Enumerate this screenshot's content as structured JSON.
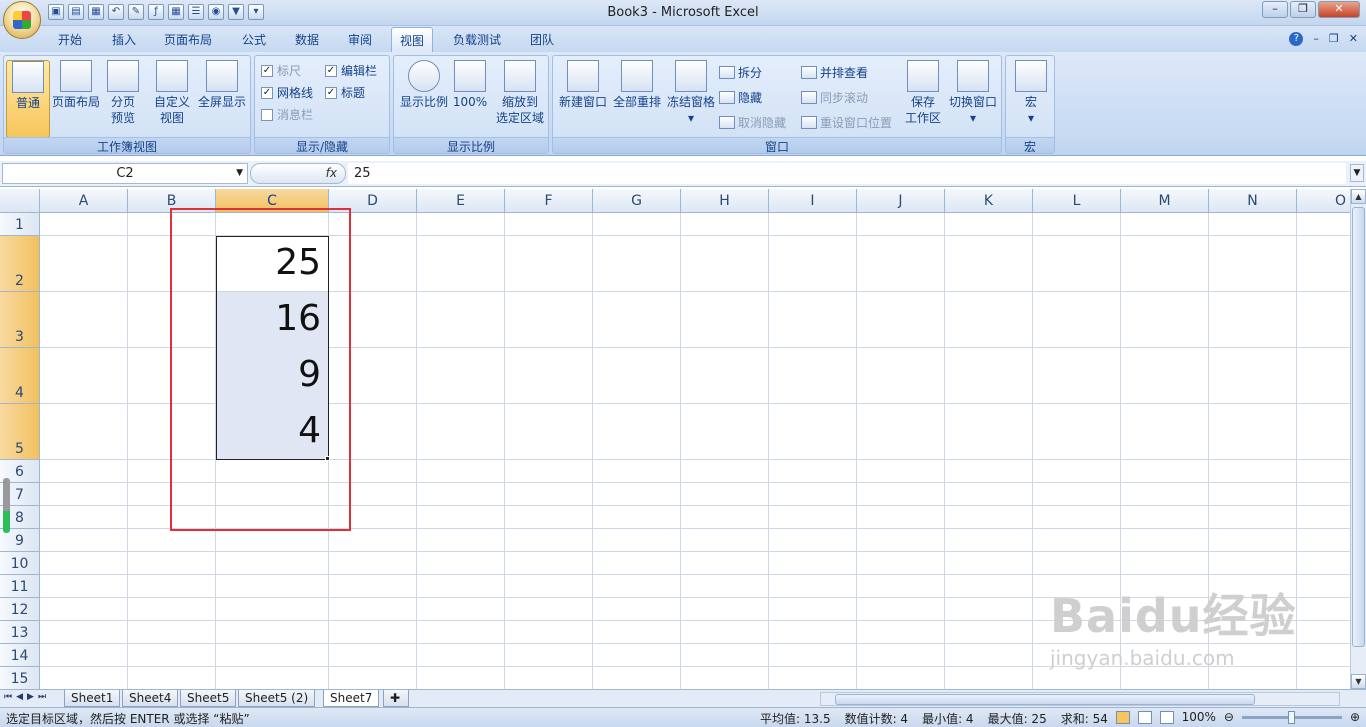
{
  "window": {
    "title": "Book3 - Microsoft Excel"
  },
  "tabs": [
    "开始",
    "插入",
    "页面布局",
    "公式",
    "数据",
    "审阅",
    "视图",
    "负载测试",
    "团队"
  ],
  "active_tab": "视图",
  "ribbon": {
    "workbook_views": {
      "label": "工作簿视图",
      "normal": "普通",
      "page_layout": "页面布局",
      "page_break_1": "分页",
      "page_break_2": "预览",
      "custom_1": "自定义",
      "custom_2": "视图",
      "fullscreen": "全屏显示"
    },
    "show_hide": {
      "label": "显示/隐藏",
      "ruler": "标尺",
      "gridlines": "网格线",
      "message_bar": "消息栏",
      "formula_bar": "编辑栏",
      "headings": "标题"
    },
    "zoom": {
      "label": "显示比例",
      "zoom": "显示比例",
      "hundred": "100%",
      "zoom_sel_1": "缩放到",
      "zoom_sel_2": "选定区域"
    },
    "window": {
      "label": "窗口",
      "new_window": "新建窗口",
      "arrange_all": "全部重排",
      "freeze": "冻结窗格",
      "split": "拆分",
      "hide": "隐藏",
      "unhide": "取消隐藏",
      "side_by_side": "并排查看",
      "sync_scroll": "同步滚动",
      "reset_pos": "重设窗口位置",
      "save_ws_1": "保存",
      "save_ws_2": "工作区",
      "switch": "切换窗口"
    },
    "macros": {
      "label": "宏",
      "macros": "宏"
    }
  },
  "formula_bar": {
    "name_box": "C2",
    "fx": "fx",
    "formula": "25"
  },
  "columns": [
    "A",
    "B",
    "C",
    "D",
    "E",
    "F",
    "G",
    "H",
    "I",
    "J",
    "K",
    "L",
    "M",
    "N",
    "O"
  ],
  "selected_column": "C",
  "rows": [
    "1",
    "2",
    "3",
    "4",
    "5",
    "6",
    "7",
    "8",
    "9",
    "10",
    "11",
    "12",
    "13",
    "14",
    "15"
  ],
  "cells": {
    "C2": "25",
    "C3": "16",
    "C4": "9",
    "C5": "4"
  },
  "sheets": [
    "Sheet1",
    "Sheet4",
    "Sheet5",
    "Sheet5 (2)",
    "Sheet7"
  ],
  "active_sheet": "Sheet7",
  "status": {
    "message": "选定目标区域，然后按 ENTER 或选择 “粘贴”",
    "average": "平均值: 13.5",
    "count": "数值计数: 4",
    "min": "最小值: 4",
    "max": "最大值: 25",
    "sum": "求和: 54",
    "zoom": "100%"
  },
  "watermark": {
    "logo": "Baidu经验",
    "url": "jingyan.baidu.com"
  }
}
